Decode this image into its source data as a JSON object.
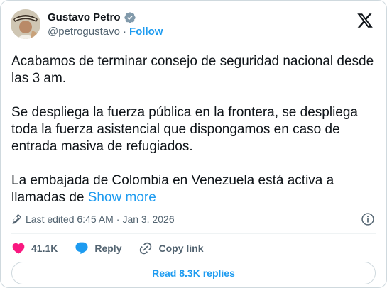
{
  "author": {
    "display_name": "Gustavo Petro",
    "handle": "@petrogustavo",
    "separator": "·",
    "follow_label": "Follow",
    "verified_icon": "verified-badge-icon"
  },
  "tweet": {
    "paragraphs": [
      "Acabamos de terminar consejo de seguridad nacional desde las 3 am.",
      "Se despliega la fuerza pública en la frontera, se despliega toda la fuerza asistencial que dispongamos en caso de entrada masiva de refugiados.",
      "La embajada de Colombia en Venezuela está activa a llamadas de"
    ],
    "show_more_label": "Show more"
  },
  "meta": {
    "last_edited": "Last edited 6:45 AM",
    "separator": "·",
    "date": "Jan 3, 2026"
  },
  "actions": {
    "likes": "41.1K",
    "reply_label": "Reply",
    "copy_link_label": "Copy link"
  },
  "replies_button": "Read 8.3K replies",
  "colors": {
    "accent": "#1d9bf0",
    "like": "#f91880",
    "text": "#0f1419",
    "muted": "#536471",
    "border": "#cfd9de"
  }
}
